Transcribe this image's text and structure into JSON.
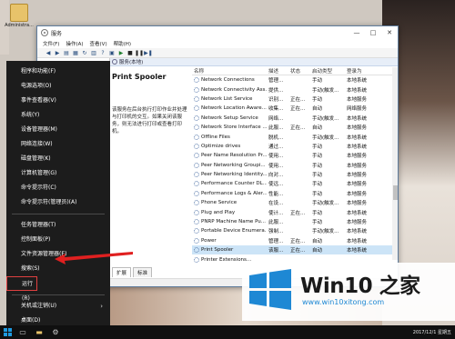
{
  "desktop": {
    "icon_label": "Administra..."
  },
  "window": {
    "title": "服务",
    "buttons": {
      "minimize": "—",
      "maximize": "□",
      "close": "✕"
    },
    "menu": [
      "文件(F)",
      "操作(A)",
      "查看(V)",
      "帮助(H)"
    ],
    "pane_header": "服务(本地)",
    "detail": {
      "name": "Print Spooler",
      "description": "该服务在后台执行打印作业并处理与打印机的交互。如果关闭该服务，则无法进行打印或查看打印机。"
    },
    "columns": [
      "名称",
      "描述",
      "状态",
      "启动类型",
      "登录为"
    ],
    "rows": [
      {
        "name": "Network Connections",
        "desc": "管理...",
        "state": "",
        "start": "手动",
        "logon": "本地系统"
      },
      {
        "name": "Network Connectivity Ass...",
        "desc": "提供...",
        "state": "",
        "start": "手动(触发...",
        "logon": "本地系统"
      },
      {
        "name": "Network List Service",
        "desc": "识别...",
        "state": "正在...",
        "start": "手动",
        "logon": "本地服务"
      },
      {
        "name": "Network Location Aware...",
        "desc": "收集...",
        "state": "正在...",
        "start": "自动",
        "logon": "网络服务"
      },
      {
        "name": "Network Setup Service",
        "desc": "网络...",
        "state": "",
        "start": "手动(触发...",
        "logon": "本地系统"
      },
      {
        "name": "Network Store Interface ...",
        "desc": "此服...",
        "state": "正在...",
        "start": "自动",
        "logon": "本地服务"
      },
      {
        "name": "Offline Files",
        "desc": "脱机...",
        "state": "",
        "start": "手动(触发...",
        "logon": "本地系统"
      },
      {
        "name": "Optimize drives",
        "desc": "通过...",
        "state": "",
        "start": "手动",
        "logon": "本地系统"
      },
      {
        "name": "Peer Name Resolution Pr...",
        "desc": "使用...",
        "state": "",
        "start": "手动",
        "logon": "本地服务"
      },
      {
        "name": "Peer Networking Groupi...",
        "desc": "使用...",
        "state": "",
        "start": "手动",
        "logon": "本地服务"
      },
      {
        "name": "Peer Networking Identity...",
        "desc": "向对...",
        "state": "",
        "start": "手动",
        "logon": "本地服务"
      },
      {
        "name": "Performance Counter DL...",
        "desc": "使远...",
        "state": "",
        "start": "手动",
        "logon": "本地服务"
      },
      {
        "name": "Performance Logs & Aler...",
        "desc": "性能...",
        "state": "",
        "start": "手动",
        "logon": "本地服务"
      },
      {
        "name": "Phone Service",
        "desc": "在设...",
        "state": "",
        "start": "手动(触发...",
        "logon": "本地服务"
      },
      {
        "name": "Plug and Play",
        "desc": "使计...",
        "state": "正在...",
        "start": "手动",
        "logon": "本地系统"
      },
      {
        "name": "PNRP Machine Name Pu...",
        "desc": "此服...",
        "state": "",
        "start": "手动",
        "logon": "本地服务"
      },
      {
        "name": "Portable Device Enumera...",
        "desc": "强制...",
        "state": "",
        "start": "手动(触发...",
        "logon": "本地系统"
      },
      {
        "name": "Power",
        "desc": "管理...",
        "state": "正在...",
        "start": "自动",
        "logon": "本地系统"
      },
      {
        "name": "Print Spooler",
        "desc": "该服...",
        "state": "正在...",
        "start": "自动",
        "logon": "本地系统"
      },
      {
        "name": "Printer Extensions...",
        "desc": "",
        "state": "",
        "start": "",
        "logon": ""
      }
    ],
    "tabs": [
      "扩展",
      "标准"
    ]
  },
  "context_menu": {
    "items": [
      {
        "label": "程序和功能(F)"
      },
      {
        "label": "电源选项(O)"
      },
      {
        "label": "事件查看器(V)"
      },
      {
        "label": "系统(Y)"
      },
      {
        "label": "设备管理器(M)"
      },
      {
        "label": "网络连接(W)"
      },
      {
        "label": "磁盘管理(K)"
      },
      {
        "label": "计算机管理(G)"
      },
      {
        "label": "命令提示符(C)"
      },
      {
        "label": "命令提示符(管理员)(A)"
      },
      {
        "label": "任务管理器(T)"
      },
      {
        "label": "控制面板(P)"
      },
      {
        "label": "文件资源管理器(E)"
      },
      {
        "label": "搜索(S)"
      },
      {
        "label": "运行(R)"
      },
      {
        "label": "关机或注销(U)",
        "arrow": "›"
      },
      {
        "label": "桌面(D)"
      }
    ]
  },
  "taskbar": {
    "clock": "2017/12/1 星期五"
  },
  "watermark": {
    "brand": "Win10 之家",
    "url": "www.win10xitong.com",
    "colors": {
      "blue": "#1e88d4"
    }
  }
}
